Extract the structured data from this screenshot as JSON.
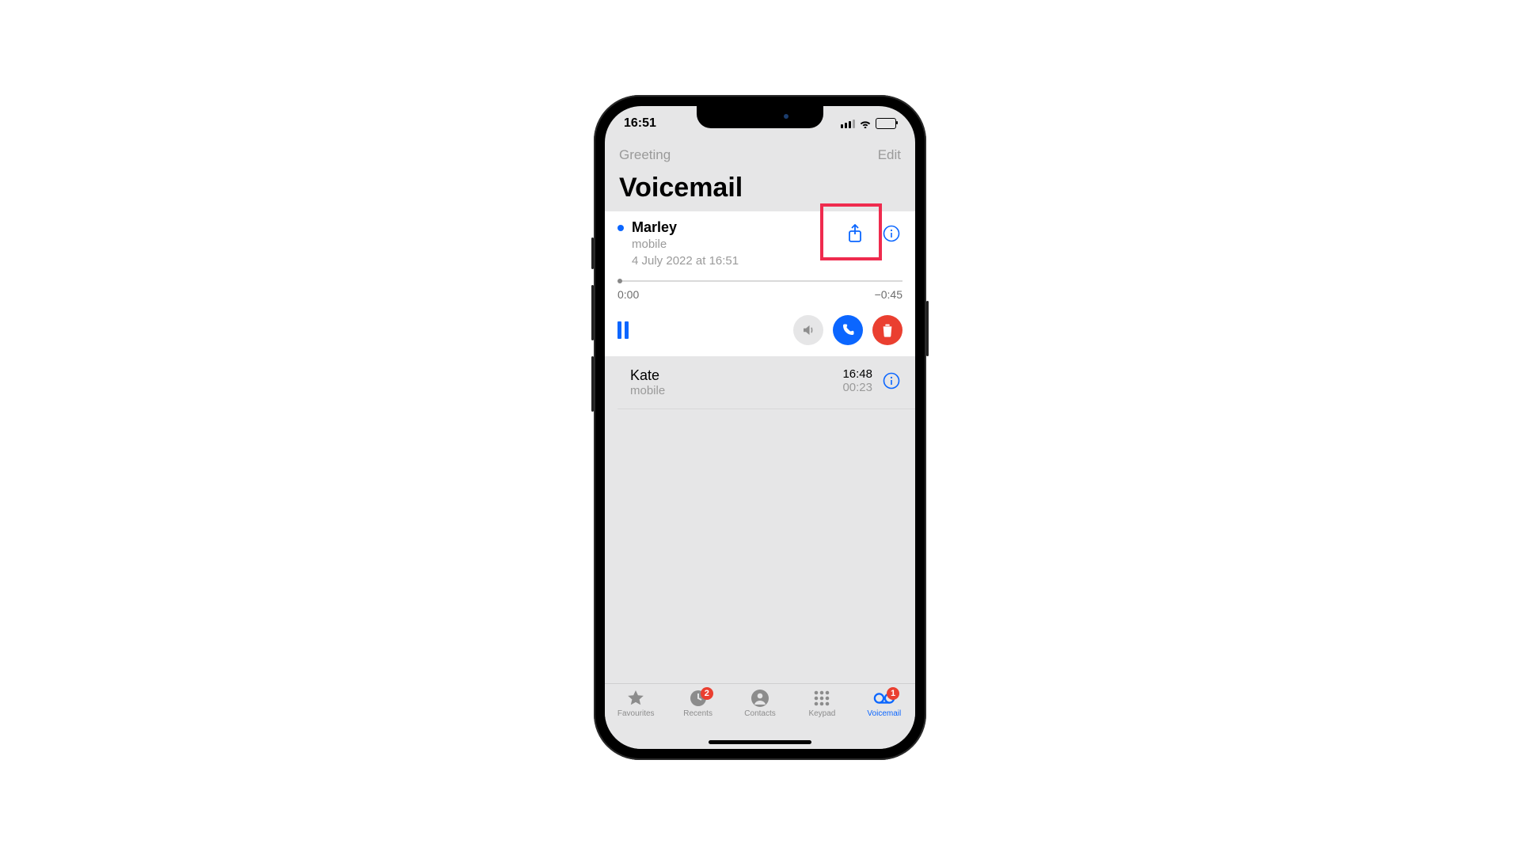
{
  "status": {
    "time": "16:51"
  },
  "navbar": {
    "left": "Greeting",
    "right": "Edit"
  },
  "page_title": "Voicemail",
  "active_vm": {
    "name": "Marley",
    "line": "mobile",
    "date": "4 July 2022 at 16:51",
    "elapsed": "0:00",
    "remaining": "−0:45"
  },
  "other_vm": {
    "name": "Kate",
    "line": "mobile",
    "time": "16:48",
    "duration": "00:23"
  },
  "tabs": {
    "favourites": "Favourites",
    "recents": "Recents",
    "contacts": "Contacts",
    "keypad": "Keypad",
    "voicemail": "Voicemail",
    "recents_badge": "2",
    "voicemail_badge": "1"
  }
}
